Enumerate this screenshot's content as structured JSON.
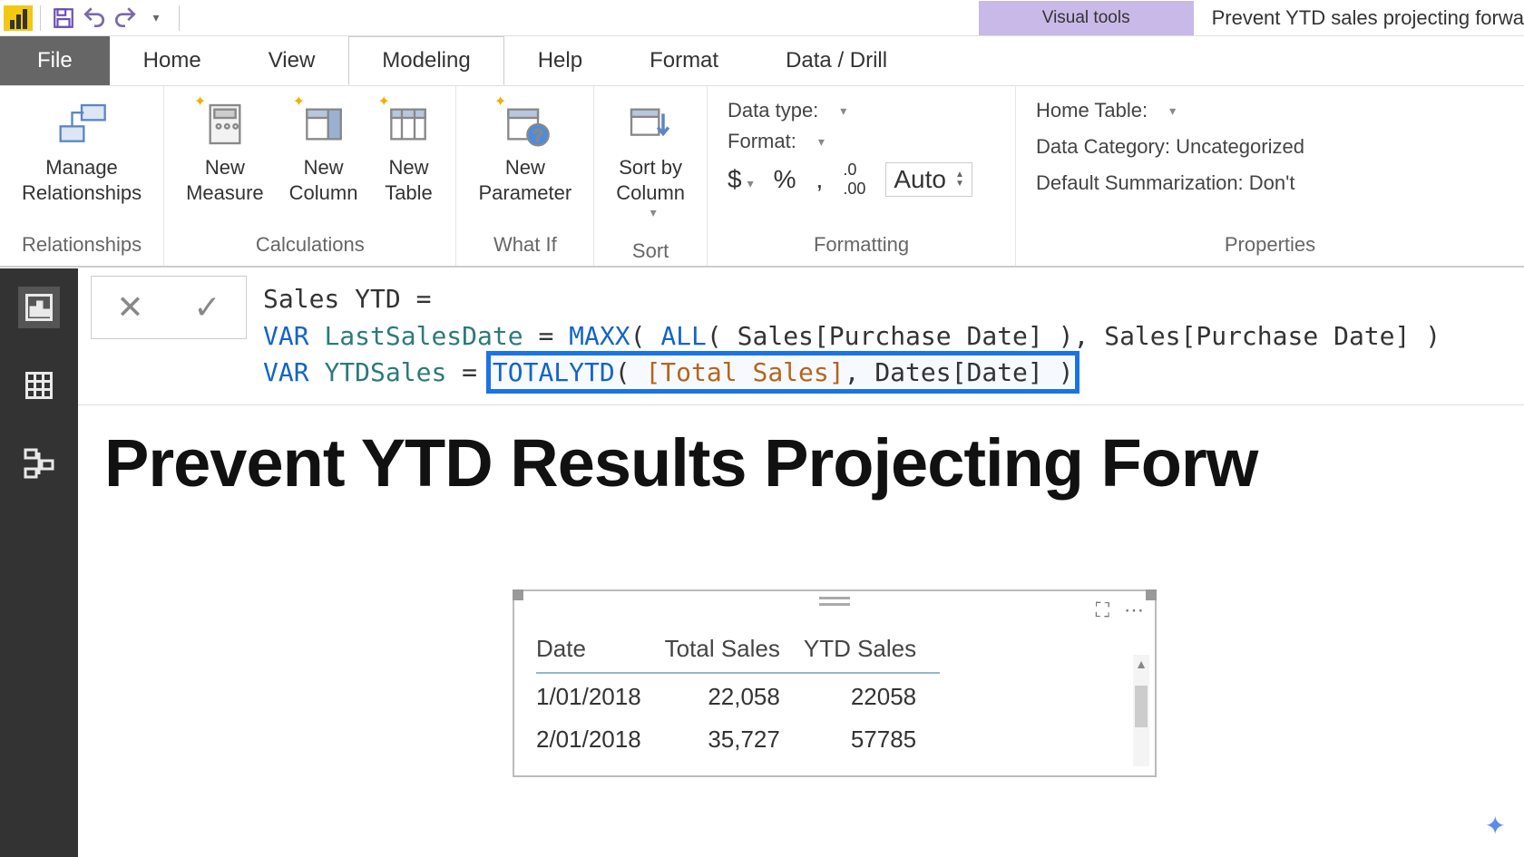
{
  "titlebar": {
    "visual_tools": "Visual tools",
    "window_title": "Prevent YTD sales projecting forwa"
  },
  "tabs": {
    "file": "File",
    "home": "Home",
    "view": "View",
    "modeling": "Modeling",
    "help": "Help",
    "format": "Format",
    "data_drill": "Data / Drill"
  },
  "ribbon": {
    "relationships": {
      "manage": "Manage\nRelationships",
      "group": "Relationships"
    },
    "calculations": {
      "measure": "New\nMeasure",
      "column": "New\nColumn",
      "table": "New\nTable",
      "group": "Calculations"
    },
    "whatif": {
      "parameter": "New\nParameter",
      "group": "What If"
    },
    "sort": {
      "sortby": "Sort by\nColumn",
      "group": "Sort"
    },
    "formatting": {
      "datatype_label": "Data type:",
      "format_label": "Format:",
      "auto": "Auto",
      "currency_symbol": "$",
      "percent_symbol": "%",
      "comma_symbol": ",",
      "decimals_icon": ".00",
      "group": "Formatting"
    },
    "properties": {
      "hometable_label": "Home Table:",
      "datacategory_label": "Data Category: Uncategorized",
      "defaultsumm_label": "Default Summarization: Don't",
      "group": "Properties"
    }
  },
  "formula": {
    "line1_measure": "Sales YTD",
    "line2_var": "LastSalesDate",
    "line2_fn1": "MAXX",
    "line2_fn2": "ALL",
    "line2_col": "Sales[Purchase Date]",
    "line3_var": "YTDSales",
    "line3_fn": "TOTALYTD",
    "line3_meas": "[Total Sales]",
    "line3_col": "Dates[Date]"
  },
  "canvas": {
    "title": "Prevent YTD Results Projecting Forw"
  },
  "table": {
    "headers": [
      "Date",
      "Total Sales",
      "YTD Sales"
    ],
    "rows": [
      {
        "date": "1/01/2018",
        "total": "22,058",
        "ytd": "22058"
      },
      {
        "date": "2/01/2018",
        "total": "35,727",
        "ytd": "57785"
      }
    ]
  }
}
